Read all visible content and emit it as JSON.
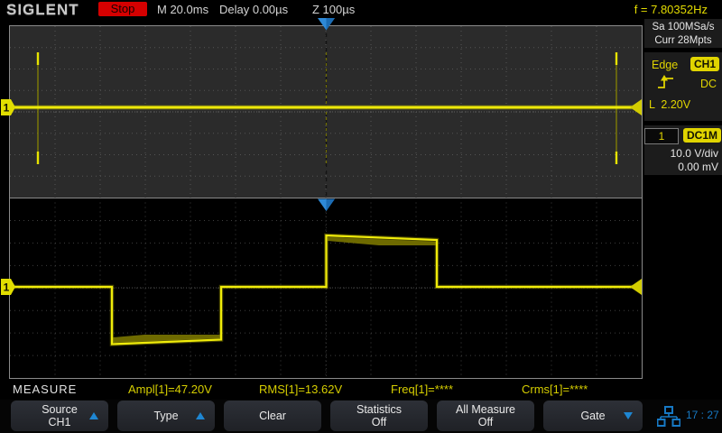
{
  "brand": "SIGLENT",
  "top_bar": {
    "acq_status": "Stop",
    "timebase": "M 20.0ms",
    "delay": "Delay 0.00µs",
    "zoom_scale": "Z 100µs",
    "freq_counter": "f = 7.80352Hz"
  },
  "sidebar": {
    "acquisition": {
      "sample_rate": "Sa 100MSa/s",
      "memory_depth": "Curr 28Mpts"
    },
    "trigger": {
      "type": "Edge",
      "source": "CH1",
      "coupling": "DC",
      "level": "L  2.20V",
      "slope_icon": "rising-edge"
    },
    "channel": {
      "number": "1",
      "coupling": "DC1M",
      "volts_per_div": "10.0 V/div",
      "offset": "0.00 mV"
    }
  },
  "scope": {
    "channel_marker": "1",
    "colors": {
      "trace_bright": "#f0ec0a",
      "trace_dim": "#8a8600",
      "trigger_blue": "#2e8ad8",
      "main_window_bg": "#2b2b2b",
      "zoom_window_bg": "#000000",
      "stop_red": "#d50000",
      "accent_yellow": "#e0d400",
      "accent_blue": "#1779c4"
    }
  },
  "measure": {
    "label": "MEASURE",
    "items": [
      "Ampl[1]=47.20V",
      "RMS[1]=13.62V",
      "Freq[1]=****",
      "Crms[1]=****"
    ]
  },
  "menu": {
    "buttons": [
      {
        "line1": "Source",
        "line2": "CH1",
        "arrow": "up"
      },
      {
        "line1": "Type",
        "line2": "",
        "arrow": "up"
      },
      {
        "line1": "Clear",
        "line2": "",
        "arrow": ""
      },
      {
        "line1": "Statistics",
        "line2": "Off",
        "arrow": ""
      },
      {
        "line1": "All Measure",
        "line2": "Off",
        "arrow": ""
      },
      {
        "line1": "Gate",
        "line2": "",
        "arrow": "down"
      }
    ]
  },
  "status": {
    "clock": "17 : 27",
    "network_icon": "lan"
  }
}
